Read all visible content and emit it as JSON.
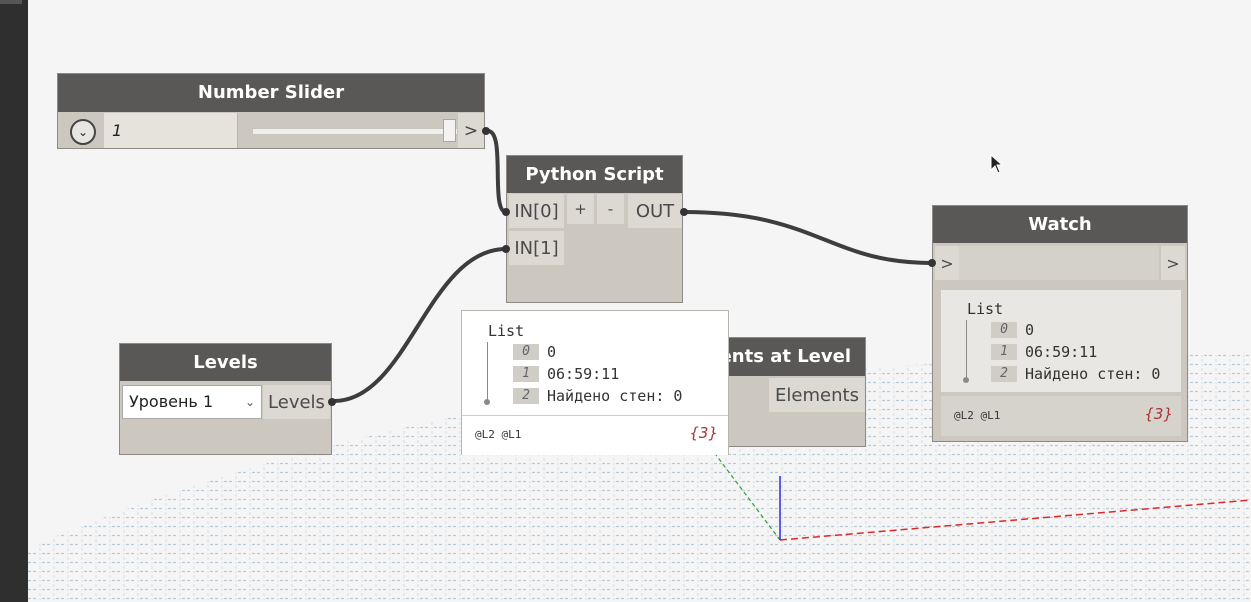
{
  "nodes": {
    "number_slider": {
      "title": "Number Slider",
      "value": "1",
      "dropdown_icon": "chevron-down-icon",
      "output_label": ">"
    },
    "python_script": {
      "title": "Python Script",
      "inputs": [
        "IN[0]",
        "IN[1]"
      ],
      "add_label": "+",
      "remove_label": "-",
      "output": "OUT"
    },
    "watch": {
      "title": "Watch",
      "input_label": ">",
      "output_label": ">",
      "list": {
        "title": "List",
        "items": [
          {
            "index": "0",
            "value": "0"
          },
          {
            "index": "1",
            "value": "06:59:11"
          },
          {
            "index": "2",
            "value": "Найдено стен: 0"
          }
        ]
      },
      "footer_levels": "@L2 @L1",
      "count": "{3}"
    },
    "levels": {
      "title": "Levels",
      "selected": "Уровень 1",
      "output": "Levels"
    },
    "elements_at_level": {
      "title": "ments at Level",
      "output": "Elements"
    }
  },
  "preview_popup": {
    "list": {
      "title": "List",
      "items": [
        {
          "index": "0",
          "value": "0"
        },
        {
          "index": "1",
          "value": "06:59:11"
        },
        {
          "index": "2",
          "value": "Найдено стен: 0"
        }
      ]
    },
    "footer_levels": "@L2 @L1",
    "count": "{3}"
  },
  "colors": {
    "node_header": "#5a5856",
    "node_body": "#ccc8c0",
    "wire": "#3d3d3d",
    "grid": "#b9cddd",
    "axis_x": "#e03030",
    "axis_y": "#30a030",
    "axis_z": "#3030e0"
  }
}
